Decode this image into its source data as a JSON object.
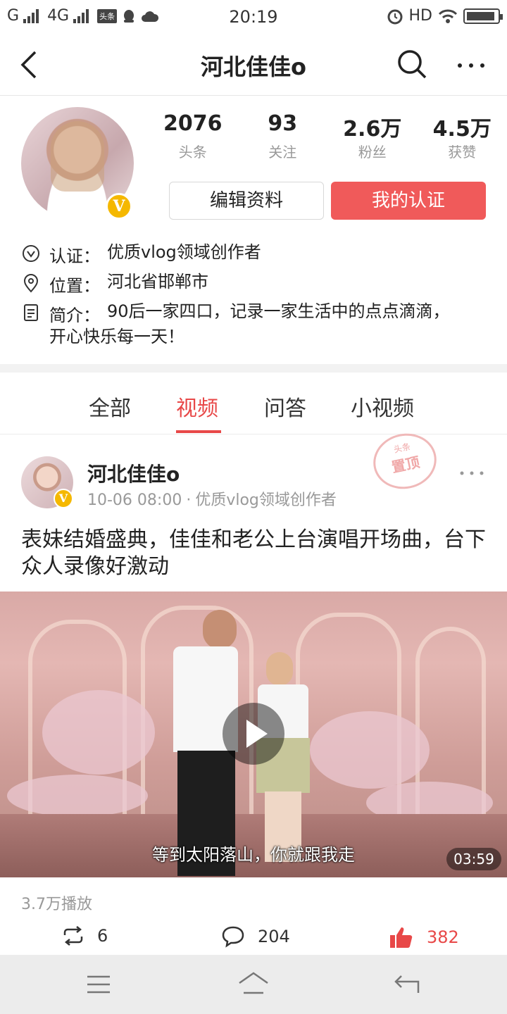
{
  "status_bar": {
    "carrier1": "G",
    "carrier2": "4G",
    "badge": "头条",
    "time": "20:19",
    "hd": "HD"
  },
  "nav": {
    "title": "河北佳佳o"
  },
  "profile": {
    "stats": [
      {
        "value": "2076",
        "label": "头条"
      },
      {
        "value": "93",
        "label": "关注"
      },
      {
        "value": "2.6万",
        "label": "粉丝"
      },
      {
        "value": "4.5万",
        "label": "获赞"
      }
    ],
    "edit_button": "编辑资料",
    "verify_button": "我的认证",
    "verified_badge": "V",
    "info": {
      "cert_key": "认证：",
      "cert_val": "优质vlog领域创作者",
      "location_key": "位置：",
      "location_val": "河北省邯郸市",
      "intro_key": "简介：",
      "intro_val": "90后一家四口，记录一家生活中的点点滴滴，",
      "intro_val2": "开心快乐每一天！"
    }
  },
  "tabs": [
    {
      "label": "全部",
      "active": false
    },
    {
      "label": "视频",
      "active": true
    },
    {
      "label": "问答",
      "active": false
    },
    {
      "label": "小视频",
      "active": false
    }
  ],
  "post": {
    "author": "河北佳佳o",
    "time": "10-06 08:00",
    "dot": "·",
    "author_tag": "优质vlog领域创作者",
    "pin_stamp_top": "头条",
    "pin_stamp_main": "置顶",
    "title": "表妹结婚盛典，佳佳和老公上台演唱开场曲，台下众人录像好激动",
    "video": {
      "subtitle": "等到太阳落山，你就跟我走",
      "duration": "03:59"
    },
    "plays": "3.7万播放",
    "shares": "6",
    "comments": "204",
    "likes": "382"
  },
  "colors": {
    "accent": "#f05a5a",
    "active_tab": "#e84848",
    "badge": "#f5b800"
  }
}
